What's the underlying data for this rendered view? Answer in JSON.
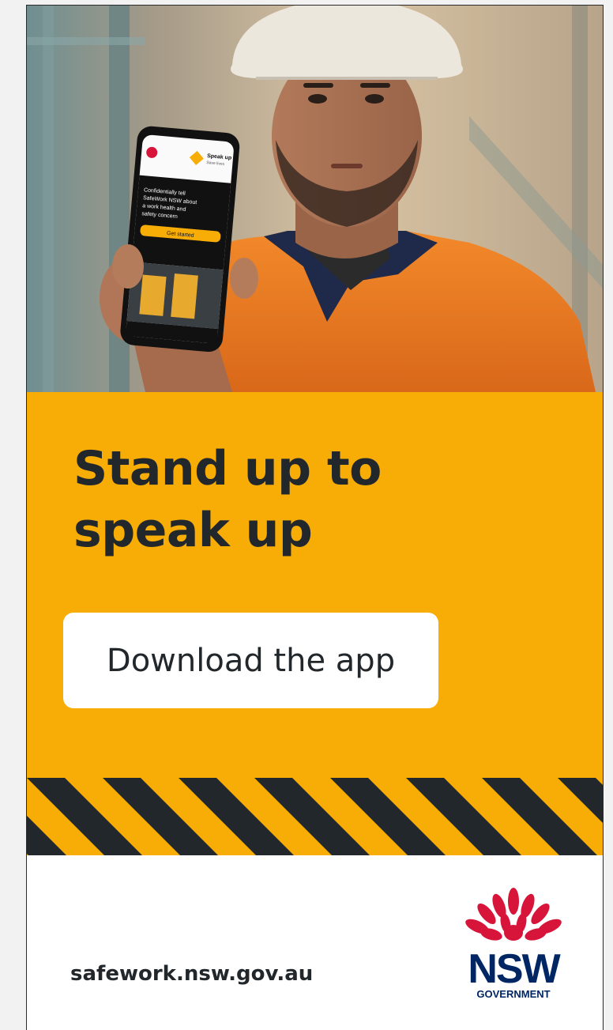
{
  "headline": {
    "line1_bold": "Stand up",
    "line1_rest": " to",
    "line2_bold": "speak up"
  },
  "cta": {
    "label": "Download the app"
  },
  "footer": {
    "url": "safework.nsw.gov.au",
    "logo_main": "NSW",
    "logo_sub": "GOVERNMENT"
  },
  "phone_screen": {
    "brand": "Speak up",
    "brand_sub": "Save lives",
    "message": [
      "Confidentially tell",
      "SafeWork NSW about",
      "a work health and",
      "safety concern"
    ],
    "button": "Get started"
  },
  "colors": {
    "panel_yellow": "#F8AC06",
    "ink": "#22272b",
    "nsw_navy": "#002664",
    "waratah_red": "#D7153A",
    "shirt_orange": "#F07C1E"
  },
  "icons": [
    "waratah-icon",
    "hazard-stripes"
  ]
}
